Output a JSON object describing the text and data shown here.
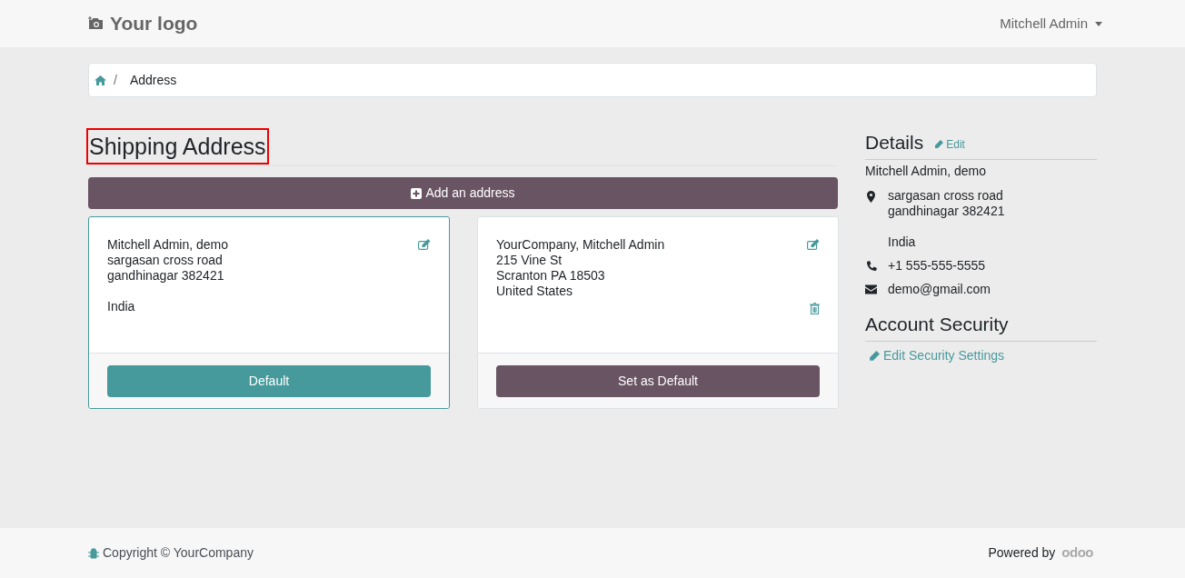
{
  "header": {
    "logo": "Your logo",
    "user_menu": "Mitchell Admin"
  },
  "breadcrumb": {
    "separator": "/",
    "current": "Address"
  },
  "shipping": {
    "title": "Shipping Address",
    "highlighted": true,
    "add_button": "Add an address",
    "addresses": [
      {
        "blocks": [
          [
            "Mitchell Admin, demo",
            "sargasan cross road",
            "gandhinagar 382421"
          ],
          [
            "India"
          ]
        ],
        "selected": true,
        "deletable": false,
        "button": "Default"
      },
      {
        "blocks": [
          [
            "YourCompany, Mitchell Admin",
            "215 Vine St",
            "Scranton PA 18503",
            "United States"
          ]
        ],
        "selected": false,
        "deletable": true,
        "button": "Set as Default"
      }
    ]
  },
  "details": {
    "title": "Details",
    "edit_link": "Edit",
    "name": "Mitchell Admin, demo",
    "items": [
      {
        "kind": "address",
        "blocks": [
          [
            "sargasan cross road",
            "gandhinagar 382421"
          ],
          [
            "India"
          ]
        ]
      },
      {
        "kind": "phone",
        "blocks": [
          [
            "+1 555-555-5555"
          ]
        ]
      },
      {
        "kind": "email",
        "blocks": [
          [
            "demo@gmail.com"
          ]
        ]
      }
    ]
  },
  "security": {
    "title": "Account Security",
    "link": "Edit Security Settings"
  },
  "footer": {
    "copyright": "Copyright © YourCompany",
    "powered_by": "Powered by",
    "brand": "odoo"
  }
}
